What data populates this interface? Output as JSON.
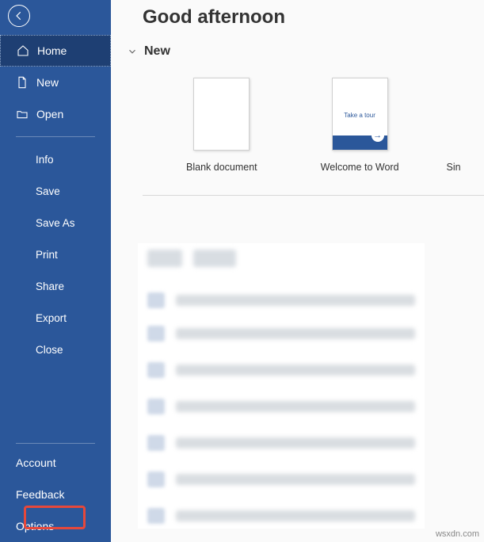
{
  "greeting": "Good afternoon",
  "section_new": "New",
  "sidebar": {
    "top": [
      {
        "label": "Home",
        "icon": "home"
      },
      {
        "label": "New",
        "icon": "doc"
      },
      {
        "label": "Open",
        "icon": "open"
      }
    ],
    "file": [
      "Info",
      "Save",
      "Save As",
      "Print",
      "Share",
      "Export",
      "Close"
    ],
    "bottom": [
      "Account",
      "Feedback",
      "Options"
    ]
  },
  "templates": [
    {
      "label": "Blank document",
      "kind": "blank"
    },
    {
      "label": "Welcome to Word",
      "kind": "welcome",
      "tour_text": "Take a tour"
    },
    {
      "label": "Sin",
      "kind": "cut"
    }
  ],
  "watermark": "wsxdn.com"
}
